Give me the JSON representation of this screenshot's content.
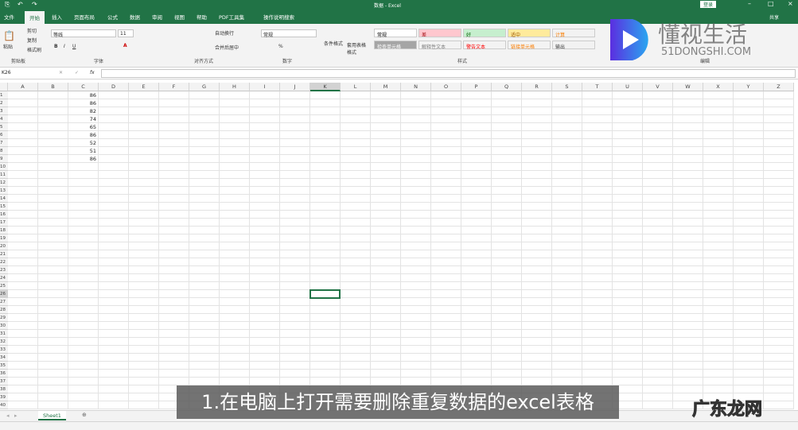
{
  "window": {
    "title": "数据 - Excel",
    "login": "登录",
    "share": "共享"
  },
  "quick_access": {
    "save": "⎘",
    "undo": "↶",
    "redo": "↷"
  },
  "tabs": [
    "文件",
    "开始",
    "插入",
    "页面布局",
    "公式",
    "数据",
    "审阅",
    "视图",
    "帮助",
    "PDF工具集",
    "操作说明搜索"
  ],
  "active_tab": "开始",
  "ribbon": {
    "clipboard": {
      "paste": "粘贴",
      "cut": "剪切",
      "copy": "复制",
      "format_painter": "格式刷",
      "label": "剪贴板"
    },
    "font": {
      "name": "等线",
      "size": "11",
      "bold": "B",
      "italic": "I",
      "underline": "U",
      "label": "字体"
    },
    "alignment": {
      "wrap": "自动换行",
      "merge": "合并后居中",
      "label": "对齐方式"
    },
    "number": {
      "format": "常规",
      "percent": "%",
      "label": "数字"
    },
    "styles": {
      "conditional": "条件格式",
      "table_format": "套用表格格式",
      "label": "样式",
      "items": [
        {
          "label": "常规",
          "bg": "#ffffff",
          "fg": "#000000"
        },
        {
          "label": "差",
          "bg": "#ffc7ce",
          "fg": "#9c0006"
        },
        {
          "label": "好",
          "bg": "#c6efce",
          "fg": "#006100"
        },
        {
          "label": "适中",
          "bg": "#ffeb9c",
          "fg": "#9c5700"
        },
        {
          "label": "计算",
          "bg": "#f2f2f2",
          "fg": "#fa7d00"
        },
        {
          "label": "检查单元格",
          "bg": "#a5a5a5",
          "fg": "#ffffff"
        },
        {
          "label": "解释性文本",
          "bg": "#f3f3f3",
          "fg": "#7f7f7f"
        },
        {
          "label": "警告文本",
          "bg": "#f3f3f3",
          "fg": "#ff0000"
        },
        {
          "label": "链接单元格",
          "bg": "#f3f3f3",
          "fg": "#fa7d00"
        },
        {
          "label": "输出",
          "bg": "#f2f2f2",
          "fg": "#3f3f3f"
        }
      ]
    },
    "editing": {
      "label": "编辑"
    }
  },
  "formula_bar": {
    "name_box": "K26",
    "fx": "fx",
    "value": ""
  },
  "columns": [
    "A",
    "B",
    "C",
    "D",
    "E",
    "F",
    "G",
    "H",
    "I",
    "J",
    "K",
    "L",
    "M",
    "N",
    "O",
    "P",
    "Q",
    "R",
    "S",
    "T",
    "U",
    "V",
    "W",
    "X",
    "Y",
    "Z"
  ],
  "row_count": 40,
  "cells": {
    "C": [
      86,
      86,
      82,
      74,
      65,
      86,
      52,
      51,
      86
    ]
  },
  "selected_cell": "K26",
  "sheets": [
    "Sheet1"
  ],
  "subtitle": "1.在电脑上打开需要删除重复数据的excel表格",
  "watermark": {
    "brand": "懂视生活",
    "url": "51DONGSHI.COM",
    "site": "广东龙网"
  },
  "colors": {
    "accent": "#217346"
  }
}
